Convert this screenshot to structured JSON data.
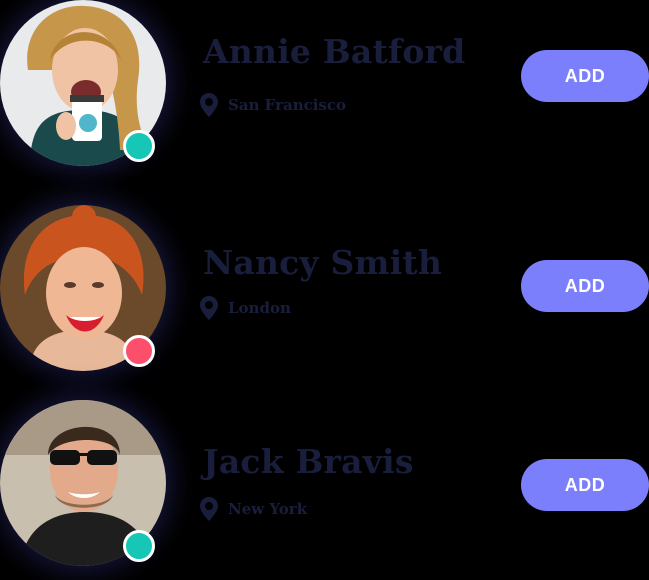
{
  "colors": {
    "background": "#000000",
    "text": "#1a1e3d",
    "button": "#7b7ffb",
    "button_text": "#ffffff",
    "status_online": "#16c7b6",
    "status_busy": "#fd4f6c"
  },
  "contacts": [
    {
      "name": "Annie Batford",
      "location": "San Francisco",
      "status_color": "#16c7b6",
      "button_label": "ADD",
      "location_icon": "map-pin-icon"
    },
    {
      "name": "Nancy Smith",
      "location": "London",
      "status_color": "#fd4f6c",
      "button_label": "ADD",
      "location_icon": "map-pin-icon"
    },
    {
      "name": "Jack Bravis",
      "location": "New York",
      "status_color": "#16c7b6",
      "button_label": "ADD",
      "location_icon": "map-pin-icon"
    }
  ]
}
